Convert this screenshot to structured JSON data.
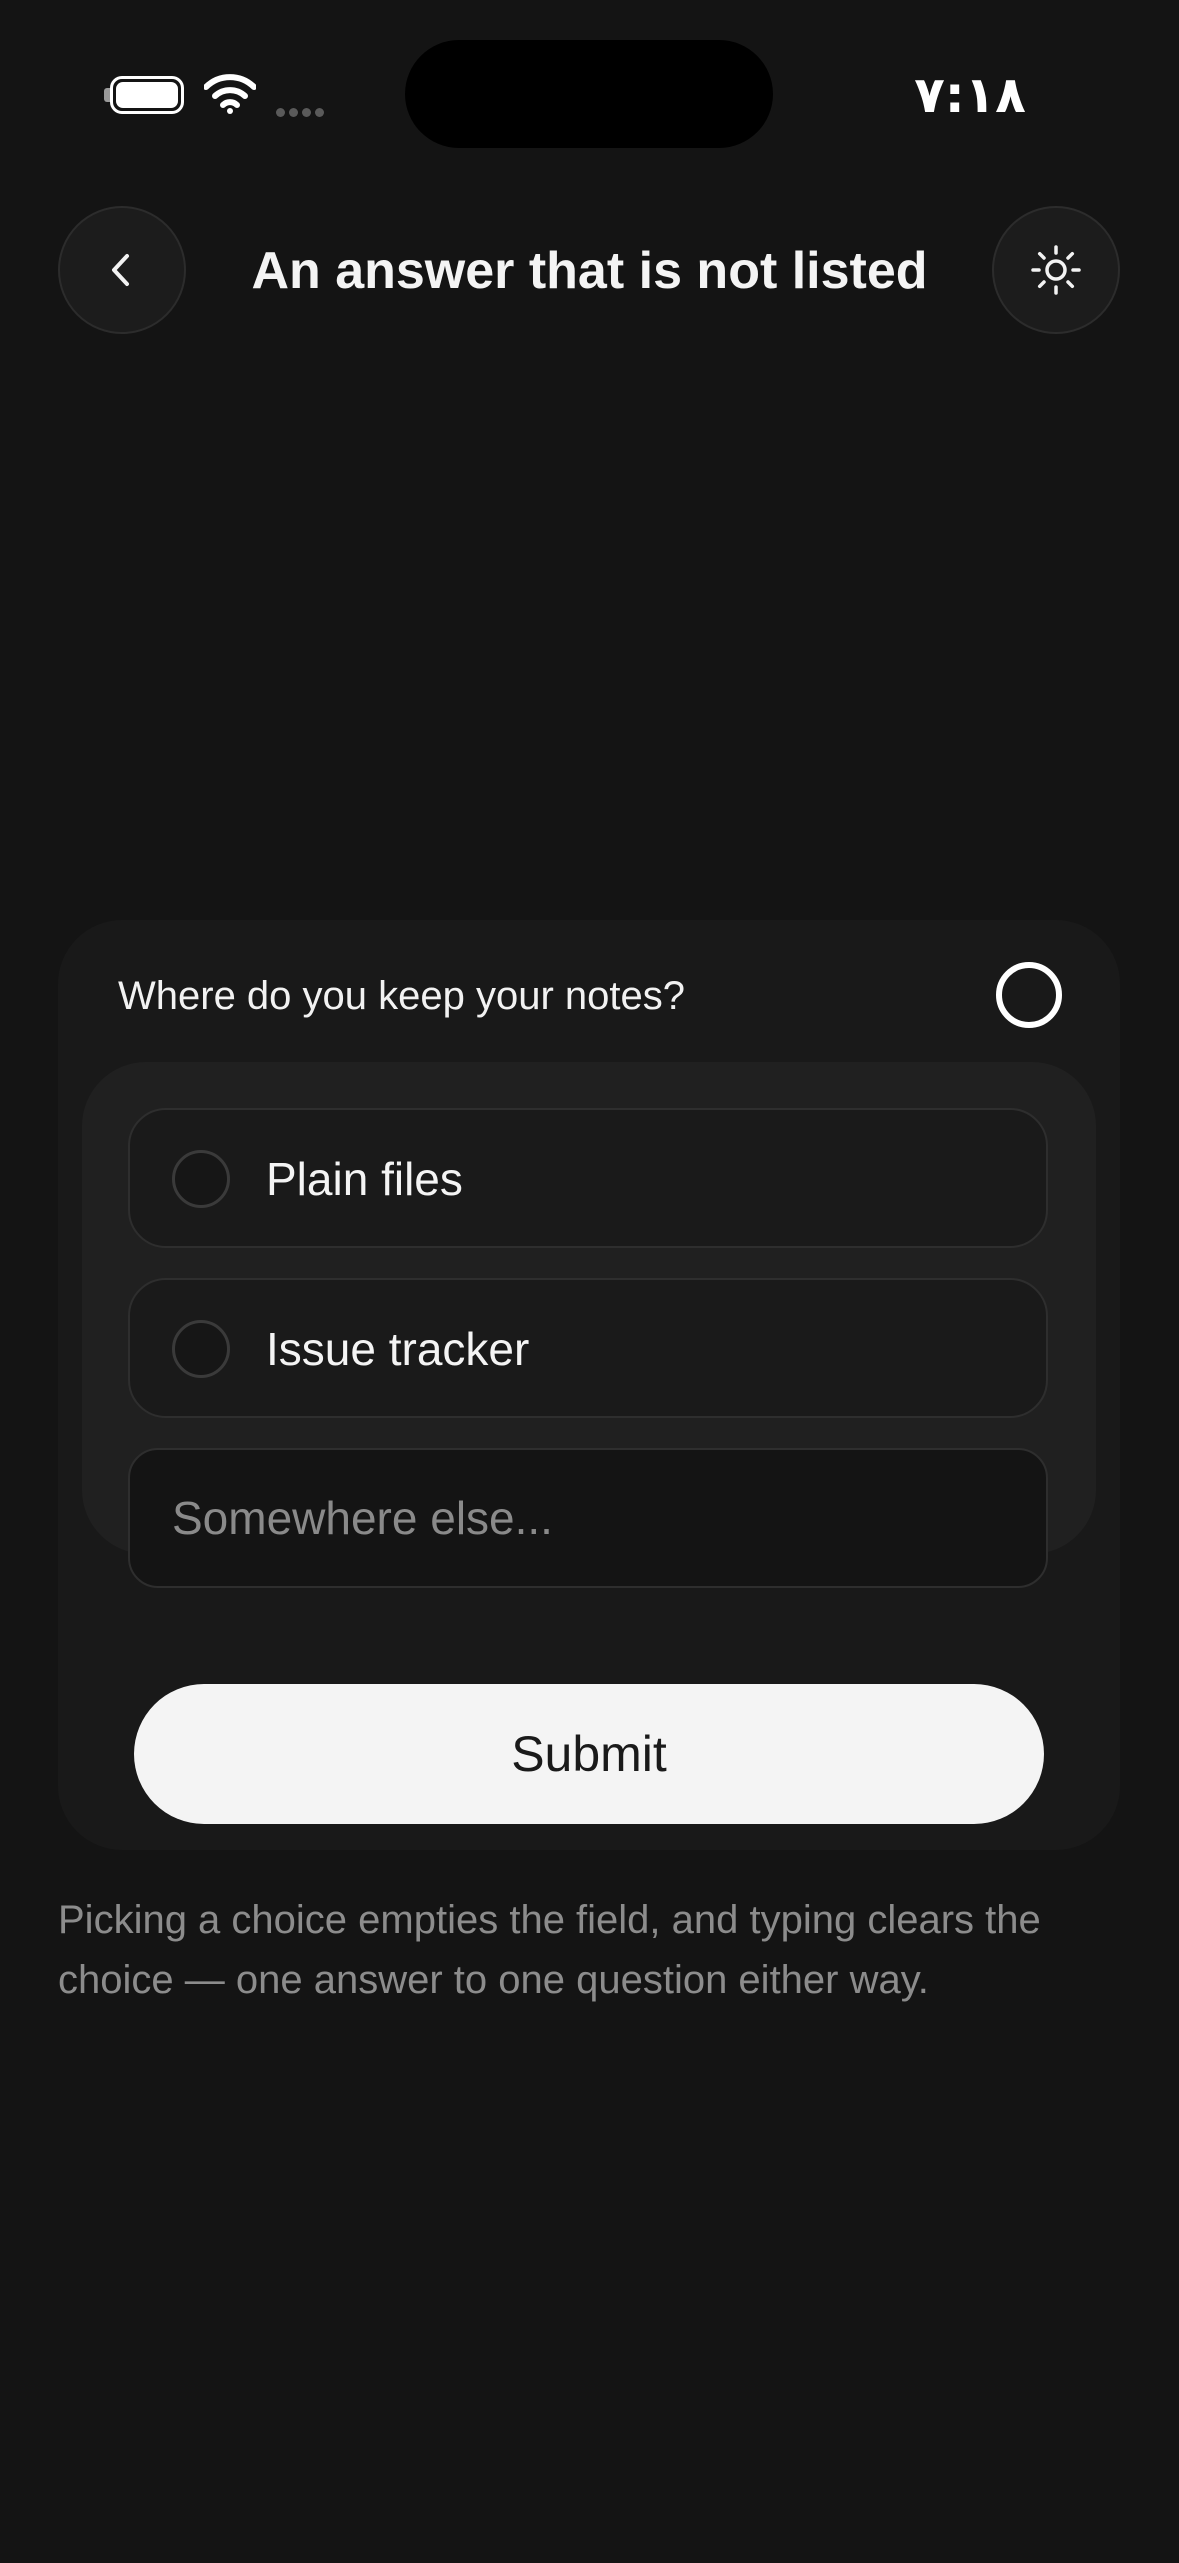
{
  "status_bar": {
    "time": "٧:١٨",
    "icons": [
      "battery-icon",
      "wifi-icon",
      "signal-icon"
    ]
  },
  "header": {
    "title": "An answer that is not listed",
    "back_icon": "chevron-left-icon",
    "theme_icon": "sun-icon"
  },
  "question_card": {
    "question": "Where do you keep your notes?",
    "options": [
      {
        "label": "Plain files",
        "selected": false
      },
      {
        "label": "Issue tracker",
        "selected": false
      }
    ],
    "other": {
      "value": "",
      "placeholder": "Somewhere else..."
    },
    "submit_label": "Submit"
  },
  "helper_text": "Picking a choice empties the field, and typing clears the choice — one answer to one question either way.",
  "colors": {
    "background": "#141414",
    "card": "#191919",
    "panel": "#202020",
    "button": "#f4f4f4",
    "muted_text": "#8c8c8c"
  }
}
